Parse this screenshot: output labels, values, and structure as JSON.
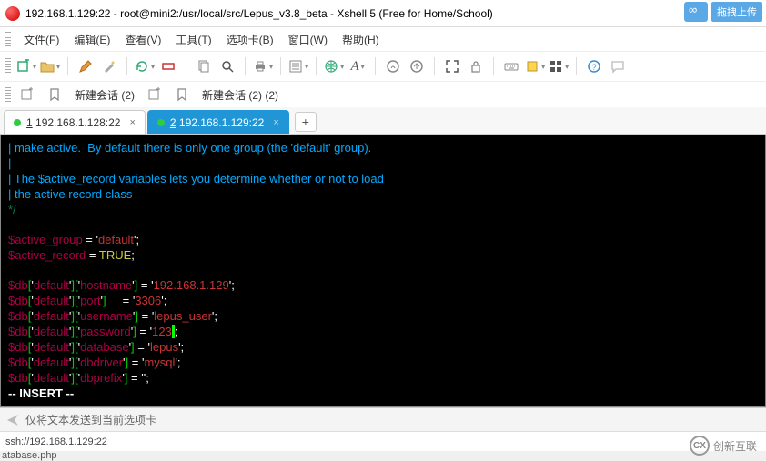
{
  "title": "192.168.1.129:22 - root@mini2:/usr/local/src/Lepus_v3.8_beta - Xshell 5 (Free for Home/School)",
  "upload_label": "拖拽上传",
  "menu": {
    "file": "文件(F)",
    "edit": "编辑(E)",
    "view": "查看(V)",
    "tools": "工具(T)",
    "tabs": "选项卡(B)",
    "window": "窗口(W)",
    "help": "帮助(H)"
  },
  "sessionbar": {
    "new1": "新建会话 (2)",
    "new2": "新建会话 (2) (2)"
  },
  "tabs": [
    {
      "label": "1 192.168.1.128:22",
      "active": false,
      "underline": "1"
    },
    {
      "label": "2 192.168.1.129:22",
      "active": true,
      "underline": "2"
    }
  ],
  "terminal": {
    "comment1": "| make active.  By default there is only one group (the 'default' group).",
    "comment2": "|",
    "comment3": "| The $active_record variables lets you determine whether or not to load",
    "comment4": "| the active record class",
    "comment_end": "*/",
    "line1_var": "$active_group",
    "line1_eq": " = ",
    "line1_q": "'",
    "line1_val": "default",
    "line1_end": "';",
    "line2_var": "$active_record",
    "line2_eq": " = ",
    "line2_val": "TRUE",
    "line2_end": ";",
    "db": "$db",
    "k_default": "default",
    "k_hostname": "hostname",
    "k_port": "port",
    "k_username": "username",
    "k_password": "password",
    "k_database": "database",
    "k_dbdriver": "dbdriver",
    "k_dbprefix": "dbprefix",
    "v_hostname": "192.168.1.129",
    "v_port": "3306",
    "v_username": "lepus_user",
    "v_password": "123",
    "v_database": "lepus",
    "v_dbdriver": "mysql",
    "v_dbprefix": "",
    "insert": "-- INSERT --"
  },
  "footer_checkbox_label": "仅将文本发送到当前选项卡",
  "statusbar": "ssh://192.168.1.129:22",
  "watermark": "创新互联",
  "bottom_cut": "atabase.php"
}
